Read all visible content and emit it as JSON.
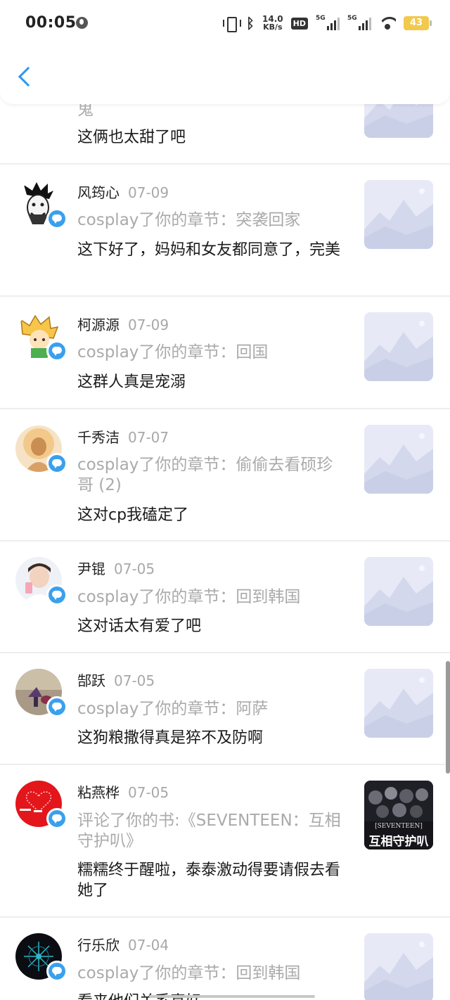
{
  "status_bar": {
    "time": "00:05",
    "net_speed_value": "14.0",
    "net_speed_unit": "KB/s",
    "hd_label": "HD",
    "signal_label": "5G",
    "battery": "43"
  },
  "colors": {
    "accent": "#2f97ee",
    "badge": "#3aa0ee",
    "battery": "#f2c94c"
  },
  "items": [
    {
      "name": "",
      "date": "",
      "action": "鬼",
      "comment": "这俩也太甜了吧"
    },
    {
      "name": "风筠心",
      "date": "07-09",
      "action": "cosplay了你的章节：突袭回家",
      "comment": "这下好了，妈妈和女友都同意了，完美"
    },
    {
      "name": "柯源源",
      "date": "07-09",
      "action": "cosplay了你的章节：回国",
      "comment": "这群人真是宠溺"
    },
    {
      "name": "千秀洁",
      "date": "07-07",
      "action": "cosplay了你的章节：偷偷去看硕珍哥 (2)",
      "comment": "这对cp我磕定了"
    },
    {
      "name": "尹锟",
      "date": "07-05",
      "action": "cosplay了你的章节：回到韩国",
      "comment": "这对话太有爱了吧"
    },
    {
      "name": "郜跃",
      "date": "07-05",
      "action": "cosplay了你的章节：阿萨",
      "comment": "这狗粮撒得真是猝不及防啊"
    },
    {
      "name": "粘燕桦",
      "date": "07-05",
      "action": "评论了你的书:《SEVENTEEN：互相守护叭》",
      "comment": "糯糯终于醒啦，泰泰激动得要请假去看她了",
      "cover_title": "互相守护叭",
      "cover_brand": "[SEVENTEEN]"
    },
    {
      "name": "行乐欣",
      "date": "07-04",
      "action": "cosplay了你的章节：回到韩国",
      "comment": "看来他们关系真好"
    }
  ]
}
